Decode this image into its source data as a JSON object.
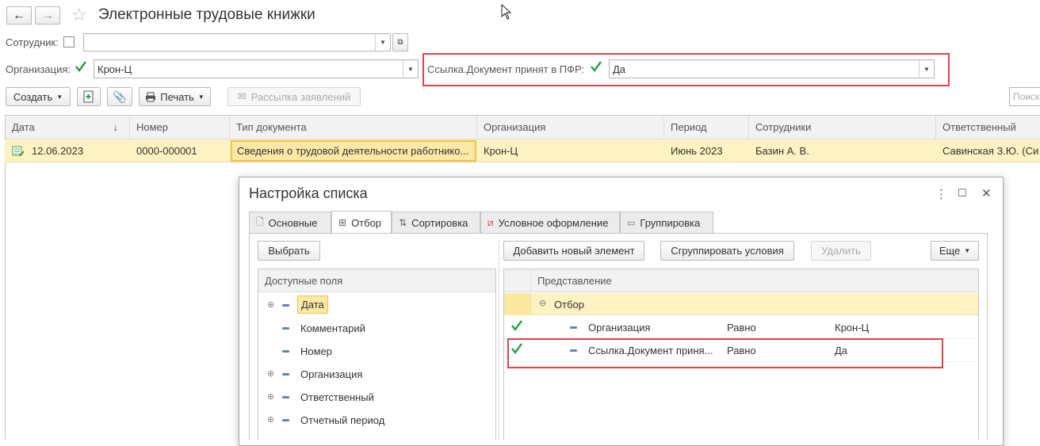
{
  "window": {
    "title": "Электронные трудовые книжки",
    "nav_back": "←",
    "nav_forward": "→",
    "star": "☆"
  },
  "filters": {
    "employee_label": "Сотрудник:",
    "employee_value": "",
    "org_label": "Организация:",
    "org_value": "Крон-Ц",
    "pfr_label": "Ссылка.Документ принят в ПФР:",
    "pfr_value": "Да"
  },
  "toolbar": {
    "create_label": "Создать",
    "print_label": "Печать",
    "mailing_label": "Рассылка заявлений",
    "search_placeholder": "Поиск"
  },
  "table": {
    "columns": [
      "Дата",
      "Номер",
      "Тип документа",
      "Организация",
      "Период",
      "Сотрудники",
      "Ответственный"
    ],
    "sort_arrow": "↓",
    "rows": [
      {
        "date": "12.06.2023",
        "number": "0000-000001",
        "type": "Сведения о трудовой деятельности работнико...",
        "org": "Крон-Ц",
        "period": "Июнь 2023",
        "employees": "Базин А. В.",
        "responsible": "Савинская З.Ю. (Си"
      }
    ]
  },
  "dialog": {
    "title": "Настройка списка",
    "more_icon": "⋮",
    "maximize_icon": "☐",
    "close_icon": "✕",
    "tabs": [
      "Основные",
      "Отбор",
      "Сортировка",
      "Условное оформление",
      "Группировка"
    ],
    "select_label": "Выбрать",
    "add_label": "Добавить новый элемент",
    "group_label": "Сгруппировать условия",
    "delete_label": "Удалить",
    "more_label": "Еще",
    "fields_header": "Доступные поля",
    "fields": [
      {
        "name": "Дата",
        "expandable": true
      },
      {
        "name": "Комментарий",
        "expandable": false
      },
      {
        "name": "Номер",
        "expandable": false
      },
      {
        "name": "Организация",
        "expandable": true
      },
      {
        "name": "Ответственный",
        "expandable": true
      },
      {
        "name": "Отчетный период",
        "expandable": true
      }
    ],
    "conditions_header": "Представление",
    "group_name": "Отбор",
    "conditions": [
      {
        "field": "Организация",
        "op": "Равно",
        "value": "Крон-Ц"
      },
      {
        "field": "Ссылка.Документ приня...",
        "op": "Равно",
        "value": "Да"
      }
    ]
  },
  "colors": {
    "accent_green": "#2aa04a",
    "highlight_row": "#fdf2c2",
    "red_box": "#e2414a"
  }
}
